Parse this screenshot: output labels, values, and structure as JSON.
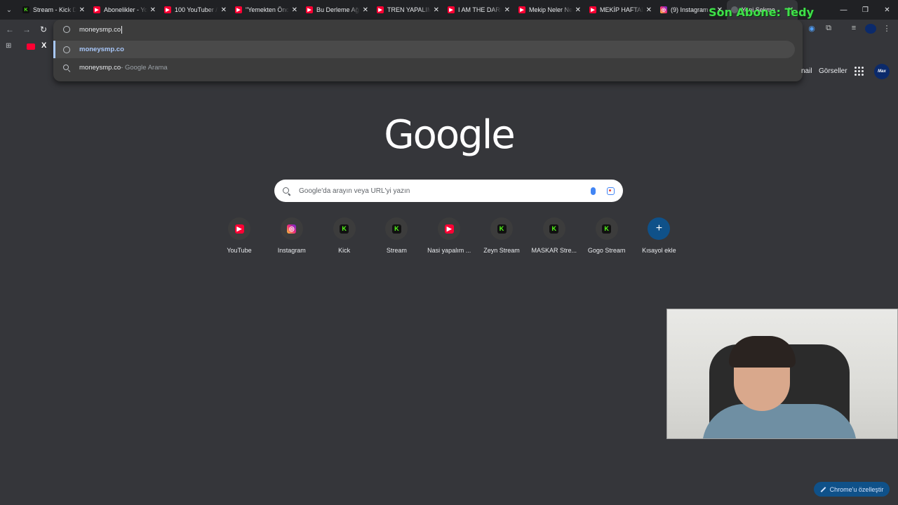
{
  "tabs": [
    {
      "title": "Stream - Kick D",
      "favicon": "kick",
      "active": false
    },
    {
      "title": "Abonelikler - Yo",
      "favicon": "youtube",
      "active": false
    },
    {
      "title": "100 YouTuber / ",
      "favicon": "youtube",
      "active": false
    },
    {
      "title": "\"Yemekten Önc",
      "favicon": "youtube",
      "active": false
    },
    {
      "title": "Bu Derleme Ağl",
      "favicon": "youtube",
      "active": false
    },
    {
      "title": "TREN YAPALIM",
      "favicon": "youtube",
      "active": false
    },
    {
      "title": "I AM THE DARK",
      "favicon": "youtube",
      "active": false
    },
    {
      "title": "Mekip Neler Ne",
      "favicon": "youtube",
      "active": false
    },
    {
      "title": "MEKİP HAFTAL",
      "favicon": "youtube",
      "active": false
    },
    {
      "title": "(9) Instagram",
      "favicon": "instagram",
      "active": false
    },
    {
      "title": "Yeni Sekme",
      "favicon": "chrome",
      "active": true
    }
  ],
  "overlay": {
    "text": "Son Abone: Tedy"
  },
  "omnibox": {
    "typed": "moneysmp.co",
    "suggestions": [
      {
        "text": "moneysmp.co",
        "suffix": "",
        "icon": "globe-icon"
      },
      {
        "text": "moneysmp.co",
        "suffix": " - Google Arama",
        "icon": "search-icon"
      }
    ]
  },
  "google_links": {
    "gmail": "nail",
    "images": "Görseller"
  },
  "search": {
    "placeholder": "Google'da arayın veya URL'yi yazın"
  },
  "shortcuts": [
    {
      "label": "YouTube",
      "favicon": "youtube"
    },
    {
      "label": "Instagram",
      "favicon": "instagram"
    },
    {
      "label": "Kick",
      "favicon": "kick"
    },
    {
      "label": "Stream",
      "favicon": "kick"
    },
    {
      "label": "Nasi yapalım ...",
      "favicon": "youtube"
    },
    {
      "label": "Zeyn Stream",
      "favicon": "kick"
    },
    {
      "label": "MASKAR Stre...",
      "favicon": "kick"
    },
    {
      "label": "Gogo Stream",
      "favicon": "kick"
    },
    {
      "label": "Kısayol ekle",
      "favicon": "add"
    }
  ],
  "customize": {
    "label": "Chrome'u özelleştir"
  },
  "logo": {
    "text": "Google"
  },
  "colors": {
    "accent": "#a8c7fa",
    "kick": "#53fc18",
    "youtube": "#ff0033",
    "background": "#35363a"
  }
}
